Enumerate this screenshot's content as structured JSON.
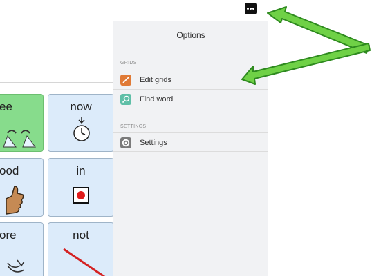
{
  "menu": {
    "title": "Options",
    "sections": [
      {
        "label": "GRIDS",
        "items": [
          {
            "label": "Edit grids",
            "icon": "pencil-icon"
          },
          {
            "label": "Find word",
            "icon": "magnifier-icon"
          }
        ]
      },
      {
        "label": "SETTINGS",
        "items": [
          {
            "label": "Settings",
            "icon": "gear-icon"
          }
        ]
      }
    ]
  },
  "tiles": [
    {
      "word": "ee",
      "icon": "eye-icon"
    },
    {
      "word": "now",
      "icon": "stopwatch-icon"
    },
    {
      "word": "ood",
      "icon": "thumbs-up-icon"
    },
    {
      "word": "in",
      "icon": "in-square-icon"
    },
    {
      "word": "ore",
      "icon": "more-icon"
    },
    {
      "word": "not",
      "icon": "diagonal-line-icon"
    }
  ],
  "colors": {
    "accent_green": "#87dc8c",
    "arrow_green": "#6fd146",
    "edit_icon": "#e07a36",
    "find_icon": "#5fbfa7",
    "settings_icon": "#7b7b7b"
  },
  "toolbar": {
    "more_icon": "ellipsis-icon"
  }
}
